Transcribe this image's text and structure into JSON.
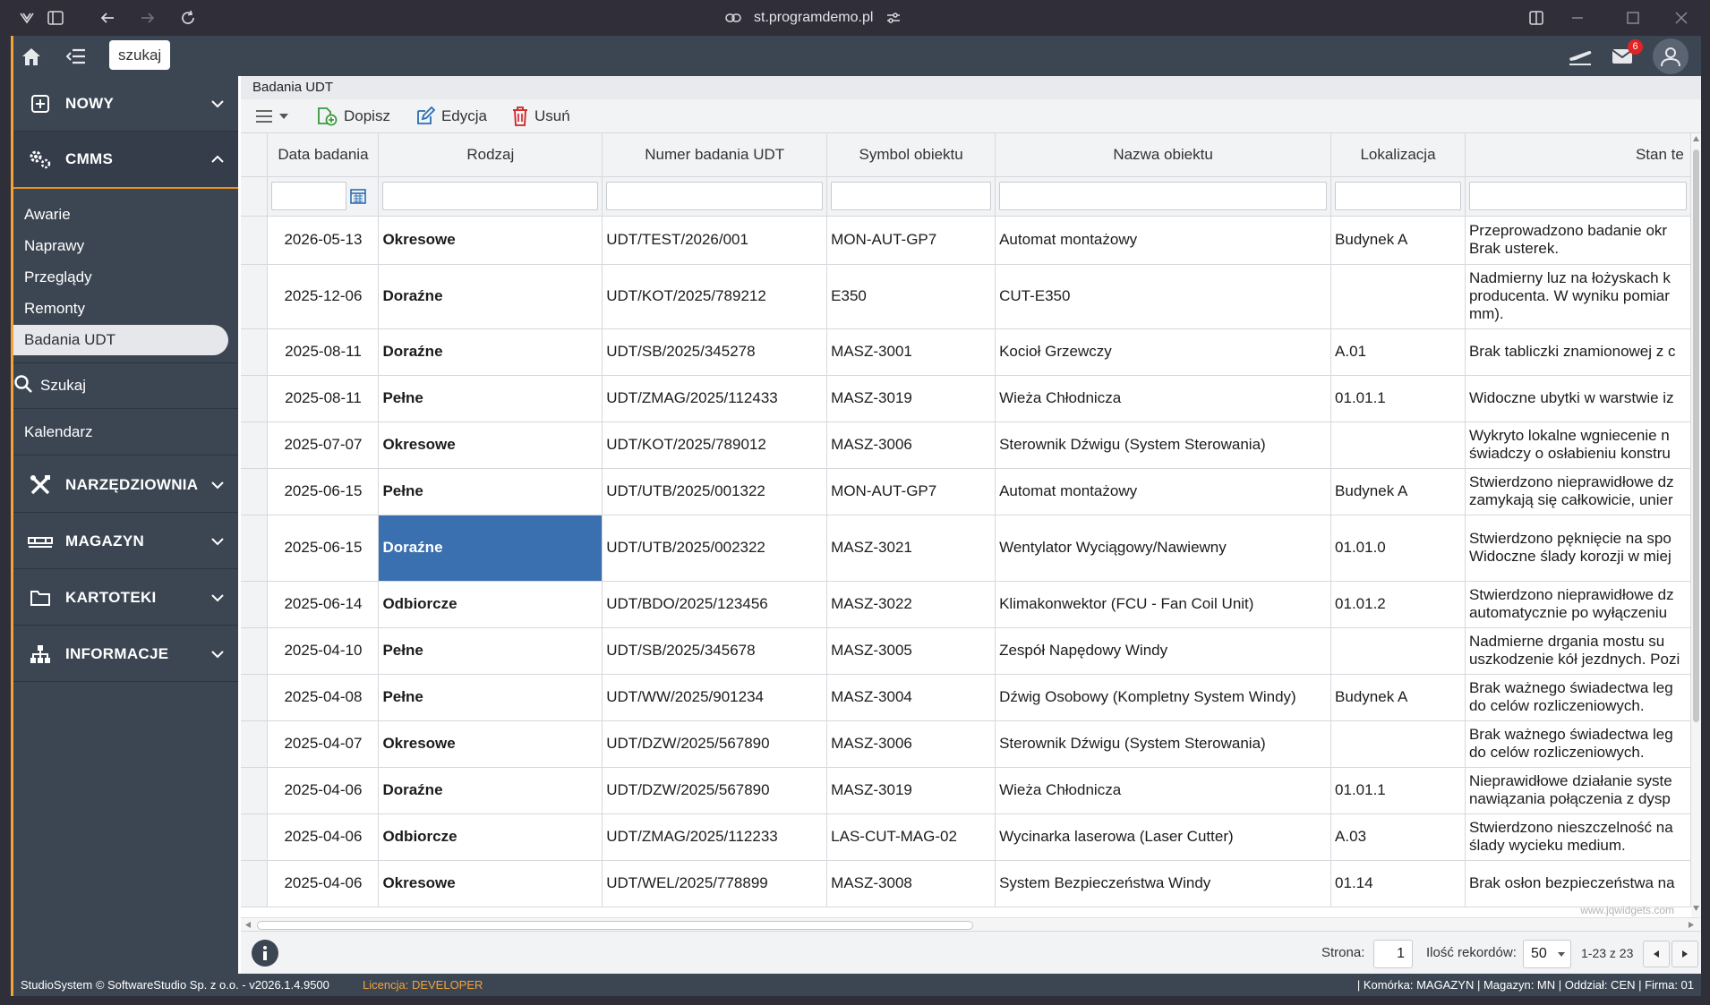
{
  "browser": {
    "url": "st.programdemo.pl"
  },
  "topbar": {
    "search_label": "szukaj",
    "mail_count": "6"
  },
  "sidebar": {
    "nowy": "NOWY",
    "cmms": "CMMS",
    "cmms_items": [
      "Awarie",
      "Naprawy",
      "Przeglądy",
      "Remonty",
      "Badania UDT"
    ],
    "szukaj": "Szukaj",
    "kalendarz": "Kalendarz",
    "narzedziownia": "NARZĘDZIOWNIA",
    "magazyn": "MAGAZYN",
    "kartoteki": "KARTOTEKI",
    "informacje": "INFORMACJE"
  },
  "main": {
    "page_title": "Badania UDT",
    "toolbar": {
      "add_label": "Dopisz",
      "edit_label": "Edycja",
      "delete_label": "Usuń"
    }
  },
  "table": {
    "columns": [
      "Data badania",
      "Rodzaj",
      "Numer badania UDT",
      "Symbol obiektu",
      "Nazwa obiektu",
      "Lokalizacja",
      "Stan te"
    ],
    "rows": [
      {
        "date": "2026-05-13",
        "kind": "Okresowe",
        "number": "UDT/TEST/2026/001",
        "symbol": "MON-AUT-GP7",
        "name": "Automat montażowy",
        "location": "Budynek A",
        "state": "Przeprowadzono badanie okr Brak usterek."
      },
      {
        "date": "2025-12-06",
        "kind": "Doraźne",
        "number": "UDT/KOT/2025/789212",
        "symbol": "E350",
        "name": "CUT-E350",
        "location": "",
        "state": "Nadmierny luz na łożyskach k producenta. W wyniku pomiar mm)."
      },
      {
        "date": "2025-08-11",
        "kind": "Doraźne",
        "number": "UDT/SB/2025/345278",
        "symbol": "MASZ-3001",
        "name": "Kocioł Grzewczy",
        "location": "A.01",
        "state": "Brak tabliczki znamionowej z c"
      },
      {
        "date": "2025-08-11",
        "kind": "Pełne",
        "number": "UDT/ZMAG/2025/112433",
        "symbol": "MASZ-3019",
        "name": "Wieża Chłodnicza",
        "location": "01.01.1",
        "state": "Widoczne ubytki w warstwie iz"
      },
      {
        "date": "2025-07-07",
        "kind": "Okresowe",
        "number": "UDT/KOT/2025/789012",
        "symbol": "MASZ-3006",
        "name": "Sterownik Dźwigu (System Sterowania)",
        "location": "",
        "state": "Wykryto lokalne wgniecenie n świadczy o osłabieniu konstru"
      },
      {
        "date": "2025-06-15",
        "kind": "Pełne",
        "number": "UDT/UTB/2025/001322",
        "symbol": "MON-AUT-GP7",
        "name": "Automat montażowy",
        "location": "Budynek A",
        "state": "Stwierdzono nieprawidłowe dz zamykają się całkowicie, unier"
      },
      {
        "date": "2025-06-15",
        "kind": "Doraźne",
        "number": "UDT/UTB/2025/002322",
        "symbol": "MASZ-3021",
        "name": "Wentylator Wyciągowy/Nawiewny",
        "location": "01.01.0",
        "state": "Stwierdzono pęknięcie na spo Widoczne ślady korozji w miej"
      },
      {
        "date": "2025-06-14",
        "kind": "Odbiorcze",
        "number": "UDT/BDO/2025/123456",
        "symbol": "MASZ-3022",
        "name": "Klimakonwektor (FCU - Fan Coil Unit)",
        "location": "01.01.2",
        "state": "Stwierdzono nieprawidłowe dz automatycznie po wyłączeniu"
      },
      {
        "date": "2025-04-10",
        "kind": "Pełne",
        "number": "UDT/SB/2025/345678",
        "symbol": "MASZ-3005",
        "name": "Zespół Napędowy Windy",
        "location": "",
        "state": "Nadmierne drgania mostu su uszkodzenie kół jezdnych. Pozi"
      },
      {
        "date": "2025-04-08",
        "kind": "Pełne",
        "number": "UDT/WW/2025/901234",
        "symbol": "MASZ-3004",
        "name": "Dźwig Osobowy (Kompletny System Windy)",
        "location": "Budynek A",
        "state": "Brak ważnego świadectwa leg do celów rozliczeniowych."
      },
      {
        "date": "2025-04-07",
        "kind": "Okresowe",
        "number": "UDT/DZW/2025/567890",
        "symbol": "MASZ-3006",
        "name": "Sterownik Dźwigu (System Sterowania)",
        "location": "",
        "state": "Brak ważnego świadectwa leg do celów rozliczeniowych."
      },
      {
        "date": "2025-04-06",
        "kind": "Doraźne",
        "number": "UDT/DZW/2025/567890",
        "symbol": "MASZ-3019",
        "name": "Wieża Chłodnicza",
        "location": "01.01.1",
        "state": "Nieprawidłowe działanie syste nawiązania połączenia z dysp"
      },
      {
        "date": "2025-04-06",
        "kind": "Odbiorcze",
        "number": "UDT/ZMAG/2025/112233",
        "symbol": "LAS-CUT-MAG-02",
        "name": "Wycinarka laserowa (Laser Cutter)",
        "location": "A.03",
        "state": "Stwierdzono nieszczelność na ślady wycieku medium."
      },
      {
        "date": "2025-04-06",
        "kind": "Okresowe",
        "number": "UDT/WEL/2025/778899",
        "symbol": "MASZ-3008",
        "name": "System Bezpieczeństwa Windy",
        "location": "01.14",
        "state": "Brak osłon bezpieczeństwa na"
      }
    ],
    "watermark": "www.jqwidgets.com"
  },
  "pager": {
    "page_label": "Strona:",
    "page_value": "1",
    "records_label": "Ilość rekordów:",
    "records_value": "50",
    "range": "1-23 z 23"
  },
  "status": {
    "left": "StudioSystem © SoftwareStudio Sp. z o.o. - v2026.1.4.9500",
    "license_label": "Licencja:",
    "license_value": "DEVELOPER",
    "right": "| Komórka: MAGAZYN | Magazyn: MN | Oddział: CEN | Firma: 01"
  },
  "colors": {
    "sidebar_bg": "#3c4653",
    "accent": "#e9901f",
    "selected_cell": "#3a6fb0",
    "license": "#f4a23a",
    "badge": "#e02424"
  }
}
